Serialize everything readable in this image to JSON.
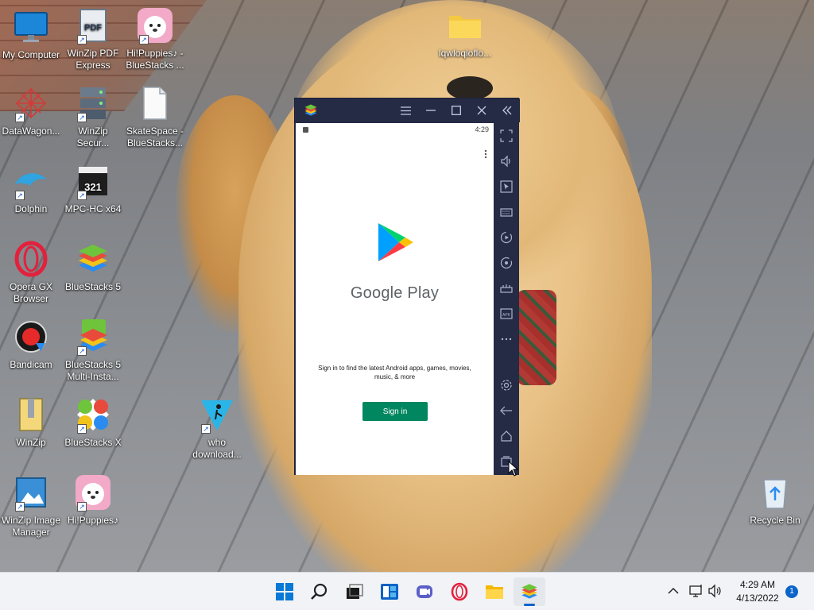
{
  "desktop": {
    "icons": [
      {
        "label": "My Computer"
      },
      {
        "label": "WinZip PDF Express"
      },
      {
        "label": "Hi!Puppies♪ - BlueStacks ..."
      },
      {
        "label": "DataWagon..."
      },
      {
        "label": "WinZip Secur..."
      },
      {
        "label": "SkateSpace - BlueStacks..."
      },
      {
        "label": "Dolphin"
      },
      {
        "label": "MPC-HC x64"
      },
      {
        "label": "Opera GX Browser"
      },
      {
        "label": "BlueStacks 5"
      },
      {
        "label": "Bandicam"
      },
      {
        "label": "BlueStacks 5 Multi-Insta..."
      },
      {
        "label": "WinZip"
      },
      {
        "label": "BlueStacks X"
      },
      {
        "label": "who download..."
      },
      {
        "label": "WinZip Image Manager"
      },
      {
        "label": "Hi!Puppies♪"
      },
      {
        "label": "lqwloqloflo..."
      },
      {
        "label": "Recycle Bin"
      }
    ]
  },
  "bluestacks": {
    "status_time": "4:29",
    "play_title": "Google Play",
    "play_description": "Sign in to find the latest Android apps, games, movies, music, & more",
    "signin_label": "Sign in",
    "sidebar_icons": [
      "fullscreen-icon",
      "volume-icon",
      "cursor-icon",
      "keyboard-icon",
      "macro-icon",
      "rotate-icon",
      "gamepad-icon",
      "apk-icon",
      "more-icon",
      "settings-icon",
      "back-icon",
      "home-icon",
      "recents-icon"
    ]
  },
  "taskbar": {
    "time": "4:29 AM",
    "date": "4/13/2022",
    "notification_count": "1"
  },
  "colors": {
    "bluestacks_frame": "#252a45",
    "play_green": "#01875f",
    "taskbar_bg": "#f1f3f6"
  }
}
